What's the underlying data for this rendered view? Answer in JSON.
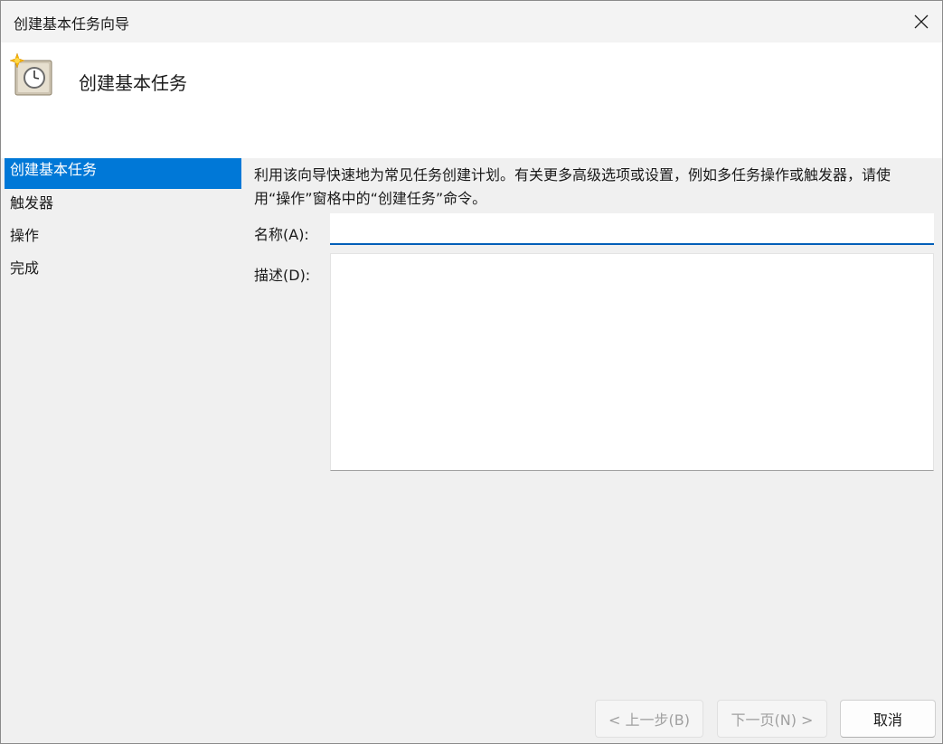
{
  "window": {
    "title": "创建基本任务向导",
    "close_icon": "close-icon"
  },
  "header": {
    "icon": "task-scheduler-clock-icon",
    "title": "创建基本任务"
  },
  "sidebar": {
    "items": [
      {
        "label": "创建基本任务",
        "active": true
      },
      {
        "label": "触发器",
        "active": false
      },
      {
        "label": "操作",
        "active": false
      },
      {
        "label": "完成",
        "active": false
      }
    ]
  },
  "main": {
    "description": "利用该向导快速地为常见任务创建计划。有关更多高级选项或设置，例如多任务操作或触发器，请使用“操作”窗格中的“创建任务”命令。",
    "name_label": "名称(A):",
    "name_value": "",
    "desc_label": "描述(D):",
    "desc_value": ""
  },
  "footer": {
    "back_label": "< 上一步(B)",
    "next_label": "下一页(N) >",
    "cancel_label": "取消"
  },
  "colors": {
    "accent": "#0078d7",
    "input_underline": "#005fb8"
  }
}
